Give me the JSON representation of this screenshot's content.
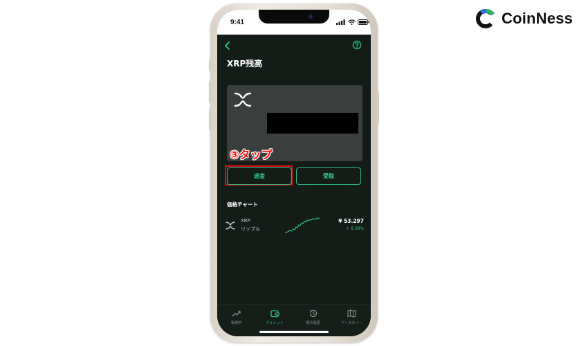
{
  "brand": {
    "name": "CoinNess",
    "colors": {
      "green": "#2dc98e",
      "dark": "#111111"
    }
  },
  "status_bar": {
    "time": "9:41"
  },
  "header": {
    "title": "XRP残高",
    "back_icon": "chevron-left-icon",
    "help_icon": "question-circle-icon"
  },
  "card": {
    "coin_icon": "xrp-logo-icon"
  },
  "annotation": {
    "text": "③タップ",
    "color": "#ff0d0d"
  },
  "actions": {
    "send_label": "送金",
    "receive_label": "受取"
  },
  "price_chart": {
    "heading": "価格チャート",
    "row": {
      "symbol": "XRP",
      "name": "リップル",
      "price": "¥ 53.297",
      "change": "+ 6.39%"
    }
  },
  "bottom_nav": {
    "items": [
      {
        "label": "販売所",
        "icon": "trend-up-icon",
        "active": false
      },
      {
        "label": "ウォレット",
        "icon": "wallet-icon",
        "active": true
      },
      {
        "label": "取引履歴",
        "icon": "history-icon",
        "active": false
      },
      {
        "label": "ディスカバー",
        "icon": "map-icon",
        "active": false
      }
    ]
  }
}
